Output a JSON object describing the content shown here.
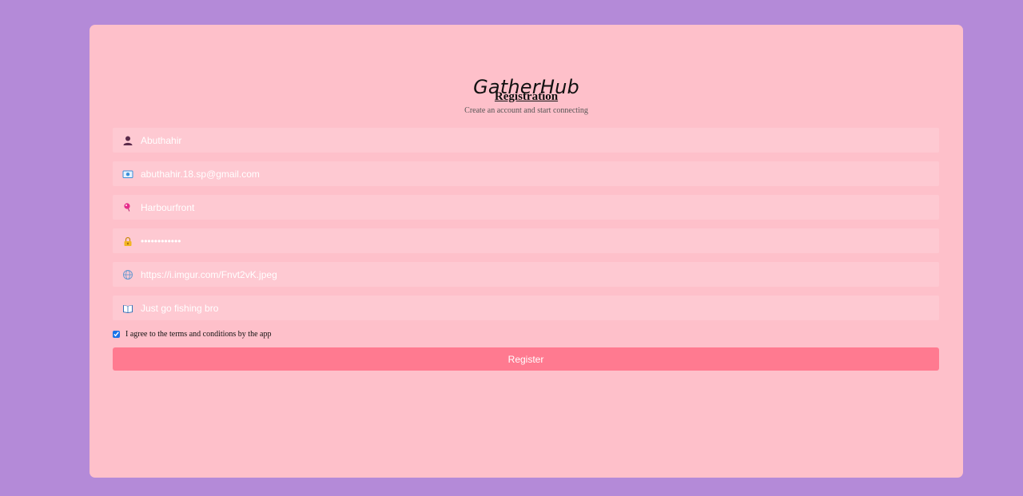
{
  "app": {
    "brand": "GatherHub"
  },
  "form": {
    "title": "Registration",
    "subtitle": "Create an account and start connecting",
    "fields": [
      {
        "name": "username",
        "icon": "user-icon",
        "value": "Abuthahir",
        "type": "text"
      },
      {
        "name": "email",
        "icon": "email-icon",
        "value": "abuthahir.18.sp@gmail.com",
        "type": "email"
      },
      {
        "name": "location",
        "icon": "location-icon",
        "value": "Harbourfront",
        "type": "text"
      },
      {
        "name": "password",
        "icon": "lock-icon",
        "value": "••••••••••••",
        "type": "password"
      },
      {
        "name": "avatar-url",
        "icon": "globe-icon",
        "value": "https://i.imgur.com/Fnvt2vK.jpeg",
        "type": "url"
      },
      {
        "name": "bio",
        "icon": "book-icon",
        "value": "Just go fishing bro",
        "type": "text"
      }
    ],
    "agree": {
      "checked": true,
      "label": "I agree to the terms and conditions by the app"
    },
    "submit_label": "Register"
  },
  "colors": {
    "page_background": "#b48ad8",
    "card_background": "#fec0ca",
    "input_background": "#fec9d2",
    "button_background": "#ff7a90"
  }
}
